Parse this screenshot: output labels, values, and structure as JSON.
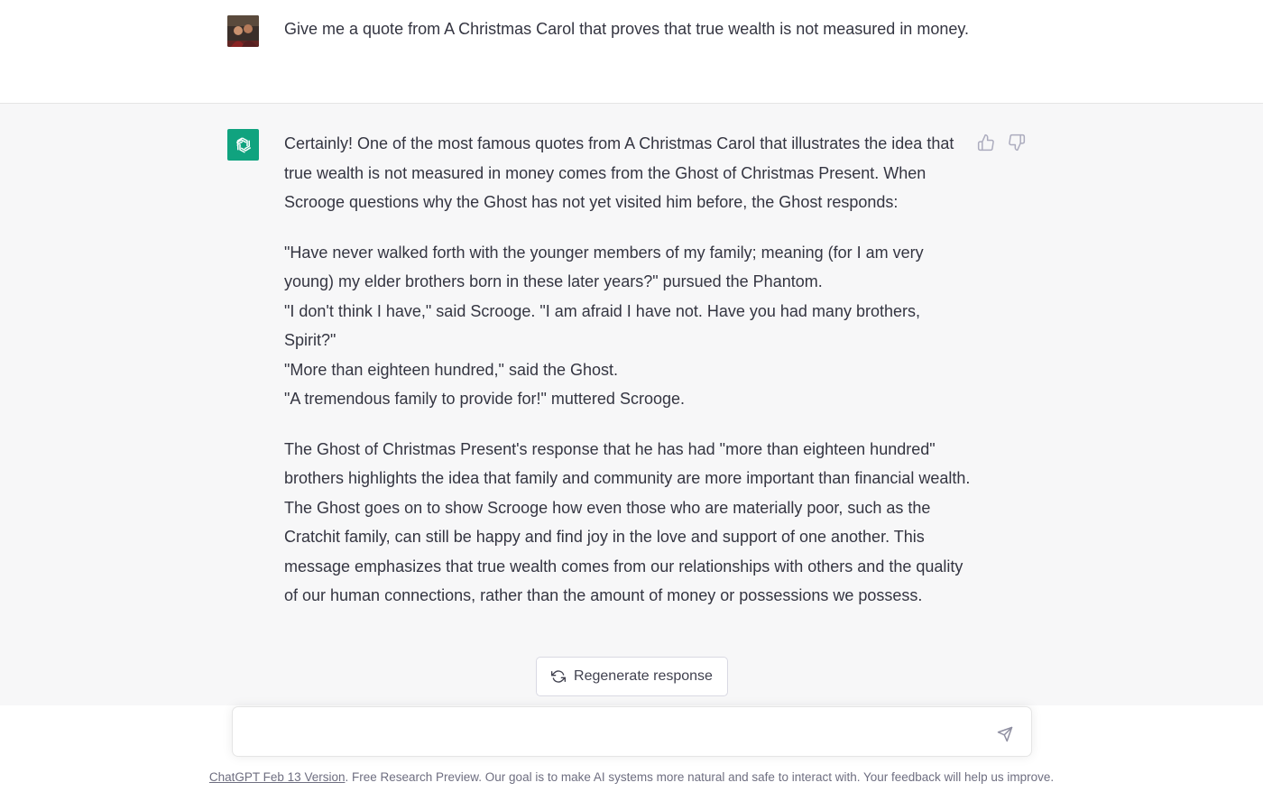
{
  "user_message": {
    "text": "Give me a quote from A Christmas Carol that proves that true wealth is not measured in money."
  },
  "assistant_message": {
    "intro": "Certainly! One of the most famous quotes from A Christmas Carol that illustrates the idea that true wealth is not measured in money comes from the Ghost of Christmas Present. When Scrooge questions why the Ghost has not yet visited him before, the Ghost responds:",
    "quote_lines": [
      "\"Have never walked forth with the younger members of my family; meaning (for I am very young) my elder brothers born in these later years?\" pursued the Phantom.",
      "\"I don't think I have,\" said Scrooge. \"I am afraid I have not. Have you had many brothers, Spirit?\"",
      "\"More than eighteen hundred,\" said the Ghost.",
      "\"A tremendous family to provide for!\" muttered Scrooge."
    ],
    "conclusion": "The Ghost of Christmas Present's response that he has had \"more than eighteen hundred\" brothers highlights the idea that family and community are more important than financial wealth. The Ghost goes on to show Scrooge how even those who are materially poor, such as the Cratchit family, can still be happy and find joy in the love and support of one another. This message emphasizes that true wealth comes from our relationships with others and the quality of our human connections, rather than the amount of money or possessions we possess."
  },
  "icons": {
    "thumbs_up": "thumbs-up-icon",
    "thumbs_down": "thumbs-down-icon",
    "regenerate": "refresh-icon",
    "send": "paper-plane-icon",
    "bot_logo": "openai-logo-icon"
  },
  "regenerate_label": "Regenerate response",
  "input": {
    "value": "",
    "placeholder": ""
  },
  "footer": {
    "link_text": "ChatGPT Feb 13 Version",
    "text": ". Free Research Preview. Our goal is to make AI systems more natural and safe to interact with. Your feedback will help us improve."
  },
  "colors": {
    "brand_green": "#10a37f",
    "assistant_bg": "#f7f7f8",
    "text": "#343541"
  }
}
